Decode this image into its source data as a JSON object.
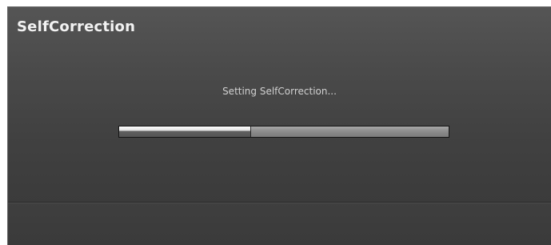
{
  "dialog": {
    "title": "SelfCorrection",
    "status_text": "Setting SelfCorrection...",
    "progress_fraction": 0.4
  },
  "colors": {
    "background": "#4a4a4a",
    "title_text": "#f2f2f2",
    "status_text": "#d0d0d0",
    "progress_fill": "#efefef",
    "progress_track": "#8d8d8d",
    "footer": "#3c3c3c"
  }
}
